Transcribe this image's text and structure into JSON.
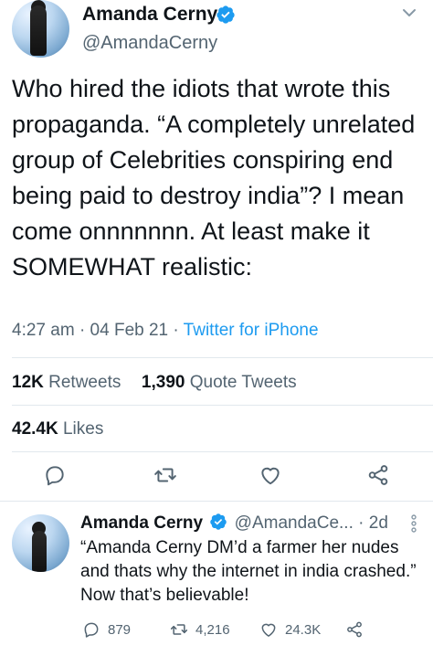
{
  "main_tweet": {
    "author_name": "Amanda Cerny",
    "author_handle": "@AmandaCerny",
    "text": "Who hired the idiots that wrote this propaganda. “A completely unrelated group of Celebrities conspiring end being paid to destroy india”? I mean come onnnnnnn. At least make it SOMEWHAT realistic:",
    "time": "4:27 am",
    "date": "04 Feb 21",
    "source": "Twitter for iPhone",
    "retweets_count": "12K",
    "retweets_label": "Retweets",
    "quote_count": "1,390",
    "quote_label": "Quote Tweets",
    "likes_count": "42.4K",
    "likes_label": "Likes"
  },
  "reply_tweet": {
    "author_name": "Amanda Cerny",
    "author_handle": "@AmandaCe...",
    "age": "2d",
    "text": "“Amanda Cerny DM’d a farmer her nudes and thats why the internet in india crashed.” Now that’s believable!",
    "replies": "879",
    "retweets": "4,216",
    "likes": "24.3K"
  },
  "icons": {
    "verified": "verified-badge-icon",
    "caret": "chevron-down-icon",
    "reply": "reply-icon",
    "retweet": "retweet-icon",
    "like": "heart-icon",
    "share": "share-icon",
    "more": "more-vertical-icon"
  },
  "colors": {
    "accent": "#1d9bf0",
    "text": "#0f1419",
    "secondary": "#536471",
    "divider": "#e1e8ed"
  }
}
